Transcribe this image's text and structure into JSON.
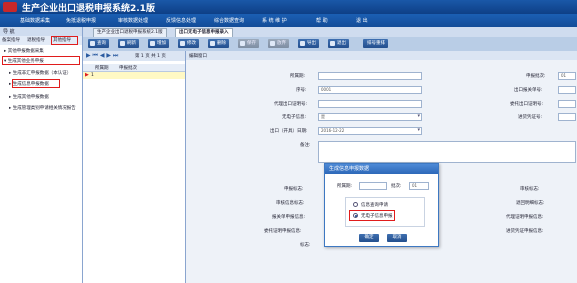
{
  "app": {
    "title": "生产企业出口退税申报系统2.1版"
  },
  "menu": [
    {
      "label": "基础数据采集"
    },
    {
      "label": "免抵退税申报"
    },
    {
      "label": "审核数据处理"
    },
    {
      "label": "反馈信息处理"
    },
    {
      "label": "综合数据查询"
    },
    {
      "label": "系 统 维 护"
    },
    {
      "label": "帮  助"
    },
    {
      "label": "退  出"
    }
  ],
  "left": {
    "header": "导  航",
    "tabs": [
      "备案指导",
      "退税指导",
      "其他指导"
    ],
    "tree": [
      {
        "label": "其他申报数据采集"
      },
      {
        "label": "生成其他业务申报"
      },
      {
        "label": "生成非汇申报数据（本认证）"
      },
      {
        "label": "生成信息申报数据"
      },
      {
        "label": "生成其他申报数据"
      },
      {
        "label": "生成管理类别申请相关情况报告"
      }
    ]
  },
  "doc_tabs": [
    "生产企业出口退税申报系统2.1版",
    "出口无电子信息申报录入"
  ],
  "toolbar": [
    {
      "label": "查询"
    },
    {
      "label": "刷新"
    },
    {
      "label": "增加"
    },
    {
      "label": "修改"
    },
    {
      "label": "删除"
    },
    {
      "label": "保存"
    },
    {
      "label": "放弃"
    },
    {
      "label": "导出"
    },
    {
      "label": "退出"
    },
    {
      "label": "排号重排"
    }
  ],
  "grid": {
    "nav_text": "第 1 页 共 1 页",
    "columns": [
      "所属期",
      "申报批次"
    ],
    "row_num": "1"
  },
  "form": {
    "header": "编辑窗口",
    "fields": {
      "ssq_label": "所属期:",
      "ssq_value": "",
      "sbpc_label": "申报批次:",
      "sbpc_value": "01",
      "xh_label": "序号:",
      "xh_value": "0001",
      "ckbgd_label": "出口报关单号:",
      "ckbgd_value": "",
      "dlzm_label": "代理出口证明号:",
      "dlzm_value": "",
      "wtzm_label": "委托出口证明号:",
      "wtzm_value": "",
      "wdz_label": "无电子信息:",
      "wdz_value": "是",
      "jhpz_label": "进货凭证号:",
      "jhpz_value": "",
      "ckrq_label": "出口（开具）日期:",
      "ckrq_value": "2016-12-22",
      "bz_label": "备注:",
      "sbbz_label": "申报标志:",
      "spbz_label": "审核标志:",
      "shxx_label": "审核信息标志:",
      "fhmx_label": "退回明细标志:",
      "bgdsb_label": "报关单申报信息:",
      "dlzms_label": "代理证明申报信息:",
      "zmxx_label": "委托证明申报信息:",
      "jhxx_label": "进货凭证申报信息:",
      "bs_label": "标志:"
    }
  },
  "dialog": {
    "title": "生成信息申报数据",
    "ssq_label": "所属期:",
    "pc_label": "批次:",
    "pc_value": "01",
    "option1": "信息查询申请",
    "option2": "无电子信息申报",
    "ok": "确定",
    "cancel": "取消"
  },
  "colors": {
    "titlebar": "#1a58a8",
    "highlight": "#e01c1c",
    "accent": "#234f8e"
  }
}
